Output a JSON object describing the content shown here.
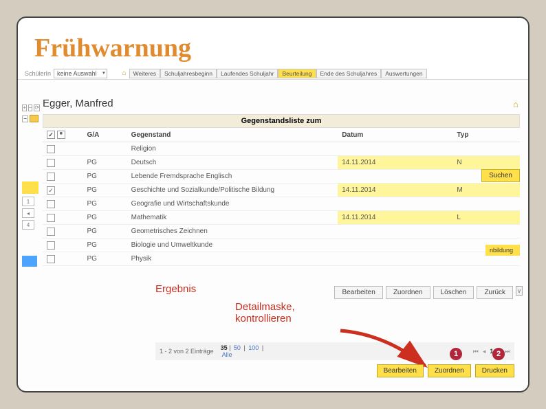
{
  "title": "Frühwarnung",
  "topbar": {
    "label_schueler": "SchülerIn",
    "select_value": "keine Auswahl",
    "tabs": [
      "Weiteres",
      "Schuljahresbeginn",
      "Laufendes Schuljahr",
      "Beurteilung",
      "Ende des Schuljahres",
      "Auswertungen"
    ],
    "active_tab_index": 3
  },
  "student": {
    "name": "Egger, Manfred"
  },
  "list_header": "Gegenstandsliste zum",
  "headers": {
    "ga": "G/A",
    "gegenstand": "Gegenstand",
    "datum": "Datum",
    "typ": "Typ"
  },
  "rows": [
    {
      "ga": "",
      "subj": "Religion",
      "date": "",
      "typ": "",
      "chk": false
    },
    {
      "ga": "PG",
      "subj": "Deutsch",
      "date": "14.11.2014",
      "typ": "N",
      "chk": false
    },
    {
      "ga": "PG",
      "subj": "Lebende Fremdsprache Englisch",
      "date": "",
      "typ": "",
      "chk": false
    },
    {
      "ga": "PG",
      "subj": "Geschichte und Sozialkunde/Politische Bildung",
      "date": "14.11.2014",
      "typ": "M",
      "chk": true
    },
    {
      "ga": "PG",
      "subj": "Geografie und Wirtschaftskunde",
      "date": "",
      "typ": "",
      "chk": false
    },
    {
      "ga": "PG",
      "subj": "Mathematik",
      "date": "14.11.2014",
      "typ": "L",
      "chk": false
    },
    {
      "ga": "PG",
      "subj": "Geometrisches Zeichnen",
      "date": "",
      "typ": "",
      "chk": false
    },
    {
      "ga": "PG",
      "subj": "Biologie und Umweltkunde",
      "date": "",
      "typ": "",
      "chk": false
    },
    {
      "ga": "PG",
      "subj": "Physik",
      "date": "",
      "typ": "",
      "chk": false
    }
  ],
  "search_label": "Suchen",
  "nbildung_label": "nbildung",
  "ergebnis_label": "Ergebnis",
  "detailmaske_l1": "Detailmaske,",
  "detailmaske_l2": "kontrollieren",
  "actions1": {
    "bearbeiten": "Bearbeiten",
    "zuordnen": "Zuordnen",
    "loeschen": "Löschen",
    "zurueck": "Zurück"
  },
  "pager": {
    "entries": "1 - 2 von 2 Einträge",
    "sizes": [
      "35",
      "50",
      "100"
    ],
    "alle": "Alle",
    "page": "1"
  },
  "actions2": {
    "bearbeiten": "Bearbeiten",
    "zuordnen": "Zuordnen",
    "drucken": "Drucken"
  },
  "markers": {
    "m1": "1",
    "m2": "2"
  }
}
